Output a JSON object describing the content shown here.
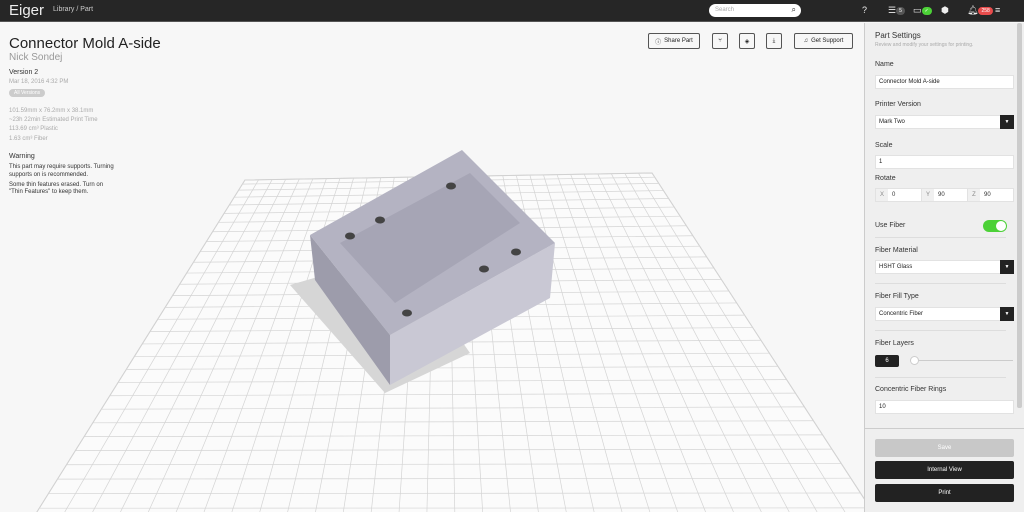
{
  "topbar": {
    "logo": "Eiger",
    "breadcrumb": "Library  /  Part",
    "search_placeholder": "Search",
    "queue_count": "5",
    "notif_count": "258"
  },
  "part": {
    "title": "Connector Mold A-side",
    "author": "Nick Sondej",
    "version": "Version 2",
    "date": "Mar 18, 2016 4:32 PM",
    "all_versions": "All Versions",
    "stats": [
      "101.59mm x 76.2mm x 38.1mm",
      "~23h 22min Estimated Print Time",
      "113.69 cm³ Plastic",
      "1.63 cm³ Fiber"
    ],
    "warning_title": "Warning",
    "warning_1": "This part may require supports. Turning supports on is recommended.",
    "warning_2": "Some thin features erased. Turn on \"Thin Features\" to keep them."
  },
  "toolbar": {
    "share": "Share Part",
    "support": "Get Support"
  },
  "settings": {
    "title": "Part Settings",
    "subtitle": "Review and modify your settings for printing.",
    "name_label": "Name",
    "name_value": "Connector Mold A-side",
    "printer_label": "Printer Version",
    "printer_value": "Mark Two",
    "scale_label": "Scale",
    "scale_value": "1",
    "rotate_label": "Rotate",
    "rx": "0",
    "ry": "90",
    "rz": "90",
    "x": "X",
    "y": "Y",
    "z": "Z",
    "fiber_label": "Use Fiber",
    "fiber_on": true,
    "material_label": "Fiber Material",
    "material_value": "HSHT Glass",
    "fill_label": "Fiber Fill Type",
    "fill_value": "Concentric Fiber",
    "layers_label": "Fiber Layers",
    "layers_value": "6",
    "rings_label": "Concentric Fiber Rings",
    "rings_value": "10",
    "save": "Save",
    "internal": "Internal View",
    "print": "Print"
  },
  "colors": {
    "toggle": "#4cd137",
    "badge": "#e84c4c",
    "model": "#b4b3c2"
  }
}
